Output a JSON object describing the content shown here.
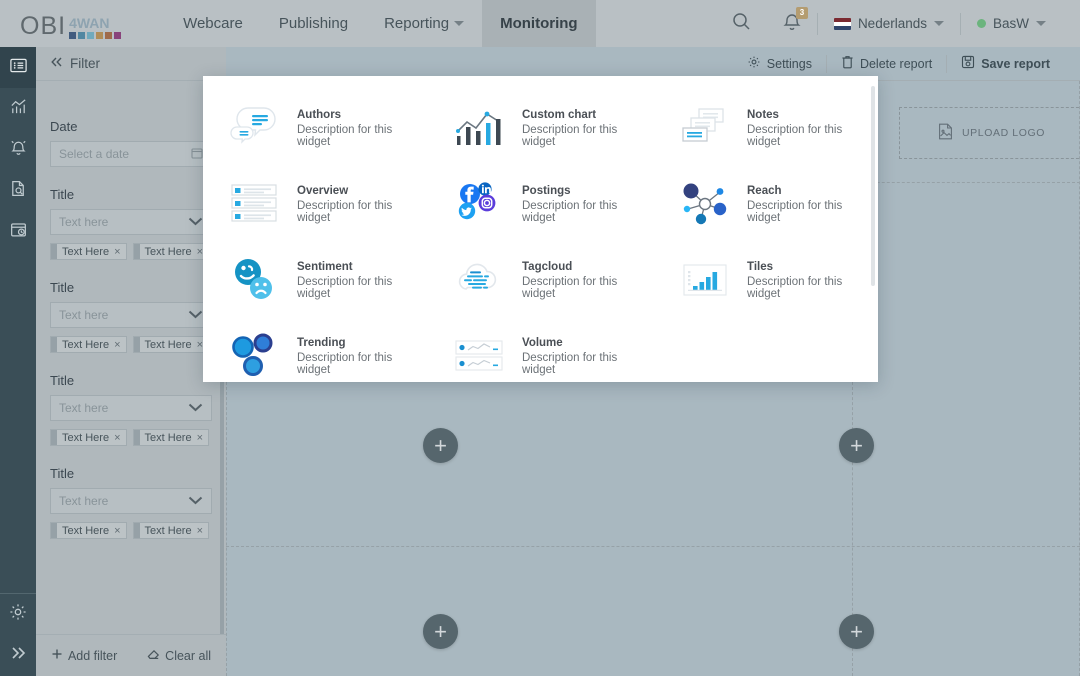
{
  "header": {
    "logo": {
      "primary": "OBI",
      "secondary": "4WAN",
      "dot_colors": [
        "#2f5f9e",
        "#2e8fbe",
        "#49b3d6",
        "#c98a2a",
        "#c2642a",
        "#b2349a"
      ]
    },
    "nav": [
      {
        "label": "Webcare",
        "active": false,
        "has_caret": false
      },
      {
        "label": "Publishing",
        "active": false,
        "has_caret": false
      },
      {
        "label": "Reporting",
        "active": false,
        "has_caret": true
      },
      {
        "label": "Monitoring",
        "active": true,
        "has_caret": false
      }
    ],
    "search_icon": "search-icon",
    "notifications": {
      "icon": "bell-icon",
      "badge": "3"
    },
    "language": {
      "label": "Nederlands",
      "flag": "netherlands-flag",
      "flag_colors": [
        "#ae1c28",
        "#ffffff",
        "#21468b"
      ]
    },
    "user": {
      "label": "BasW",
      "status_color": "#3fc460"
    }
  },
  "rail": {
    "items": [
      {
        "name": "reports-icon",
        "active": true
      },
      {
        "name": "analytics-chart-icon",
        "active": false
      },
      {
        "name": "alerts-bell-icon",
        "active": false
      },
      {
        "name": "document-search-icon",
        "active": false
      },
      {
        "name": "calendar-clock-icon",
        "active": false
      }
    ],
    "bottom": [
      {
        "name": "settings-gear-icon"
      },
      {
        "name": "expand-chevrons-icon"
      }
    ]
  },
  "filter": {
    "title": "Filter",
    "collapse_icon": "double-chevron-left-icon",
    "fields": [
      {
        "label": "Date",
        "placeholder": "Select a date",
        "type": "date",
        "icon": "calendar-icon",
        "chips": []
      },
      {
        "label": "Title",
        "placeholder": "Text here",
        "type": "select",
        "icon": "chevron-down-icon",
        "chips": [
          "Text Here",
          "Text Here"
        ]
      },
      {
        "label": "Title",
        "placeholder": "Text here",
        "type": "select",
        "icon": "chevron-down-icon",
        "chips": [
          "Text Here",
          "Text Here"
        ]
      },
      {
        "label": "Title",
        "placeholder": "Text here",
        "type": "select",
        "icon": "chevron-down-icon",
        "chips": [
          "Text Here",
          "Text Here"
        ]
      },
      {
        "label": "Title",
        "placeholder": "Text here",
        "type": "select",
        "icon": "chevron-down-icon",
        "chips": [
          "Text Here",
          "Text Here"
        ]
      }
    ],
    "chip_remove_label": "×",
    "footer": {
      "add_filter": "Add filter",
      "add_icon": "plus-icon",
      "clear_all": "Clear all",
      "clear_icon": "eraser-icon"
    }
  },
  "toolbar": {
    "settings": {
      "label": "Settings",
      "icon": "gear-icon"
    },
    "delete_report": {
      "label": "Delete report",
      "icon": "trash-icon"
    },
    "save_report": {
      "label": "Save report",
      "icon": "save-disk-icon"
    }
  },
  "canvas": {
    "upload_logo": {
      "label": "UPLOAD LOGO",
      "icon": "image-placeholder-icon"
    },
    "add_buttons": [
      {
        "name": "add-widget-button-top-left",
        "symbol": "+"
      },
      {
        "name": "add-widget-button-top-right",
        "symbol": "+"
      },
      {
        "name": "add-widget-button-bottom-left",
        "symbol": "+"
      },
      {
        "name": "add-widget-button-bottom-right",
        "symbol": "+"
      }
    ]
  },
  "widget_picker": {
    "widgets": [
      {
        "title": "Authors",
        "description": "Description for this widget",
        "icon": "authors-speech-bubble-icon"
      },
      {
        "title": "Custom chart",
        "description": "Description for this widget",
        "icon": "custom-chart-bar-line-icon"
      },
      {
        "title": "Notes",
        "description": "Description for this widget",
        "icon": "notes-cards-icon"
      },
      {
        "title": "Overview",
        "description": "Description for this widget",
        "icon": "overview-list-rows-icon"
      },
      {
        "title": "Postings",
        "description": "Description for this widget",
        "icon": "postings-social-networks-icon"
      },
      {
        "title": "Reach",
        "description": "Description for this widget",
        "icon": "reach-network-nodes-icon"
      },
      {
        "title": "Sentiment",
        "description": "Description for this widget",
        "icon": "sentiment-smiley-faces-icon"
      },
      {
        "title": "Tagcloud",
        "description": "Description for this widget",
        "icon": "tagcloud-cloud-icon"
      },
      {
        "title": "Tiles",
        "description": "Description for this widget",
        "icon": "tiles-bar-panel-icon"
      },
      {
        "title": "Trending",
        "description": "Description for this widget",
        "icon": "trending-circles-icon"
      },
      {
        "title": "Volume",
        "description": "Description for this widget",
        "icon": "volume-sparkline-rows-icon"
      }
    ]
  },
  "palette": {
    "header_bg": "#b4c1c8",
    "rail_bg": "#2d5161",
    "canvas_bg": "#a9b8c0",
    "accent_blue": "#27a9e1",
    "deep_blue": "#2b3f8f",
    "modal_bg": "#ffffff"
  }
}
